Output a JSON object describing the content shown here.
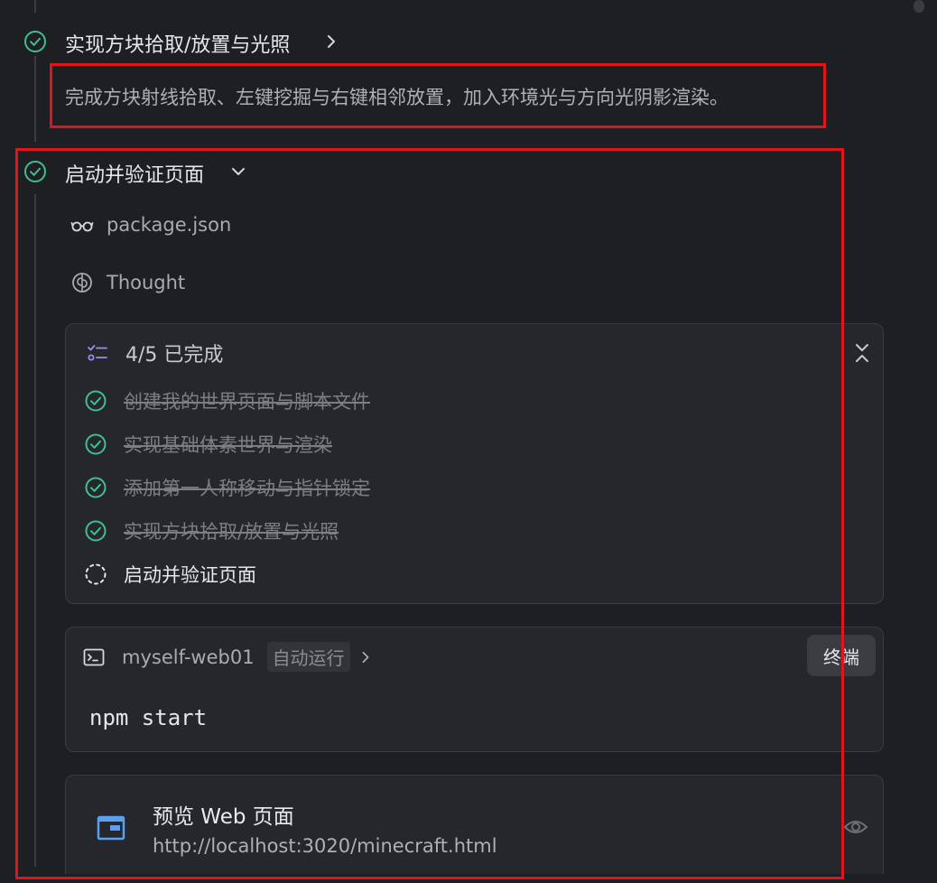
{
  "steps": [
    {
      "title": "实现方块拾取/放置与光照",
      "description": "完成方块射线拾取、左键挖掘与右键相邻放置，加入环境光与方向光阴影渲染。",
      "status": "done"
    },
    {
      "title": "启动并验证页面",
      "status": "done"
    }
  ],
  "activity": {
    "file_read": "package.json",
    "thought": "Thought"
  },
  "todo": {
    "summary": "4/5 已完成",
    "items": [
      {
        "label": "创建我的世界页面与脚本文件",
        "status": "done"
      },
      {
        "label": "实现基础体素世界与渲染",
        "status": "done"
      },
      {
        "label": "添加第一人称移动与指针锁定",
        "status": "done"
      },
      {
        "label": "实现方块拾取/放置与光照",
        "status": "done"
      },
      {
        "label": "启动并验证页面",
        "status": "in-progress"
      }
    ]
  },
  "terminal": {
    "cwd": "myself-web01",
    "mode_badge": "自动运行",
    "button_label": "终端",
    "command": "npm start"
  },
  "preview": {
    "title": "预览 Web 页面",
    "url": "http://localhost:3020/minecraft.html"
  },
  "colors": {
    "accent_green": "#3fbf8f",
    "highlight_red": "#e0141c",
    "background": "#1e1f23",
    "preview_icon": "#5aa0f0"
  }
}
